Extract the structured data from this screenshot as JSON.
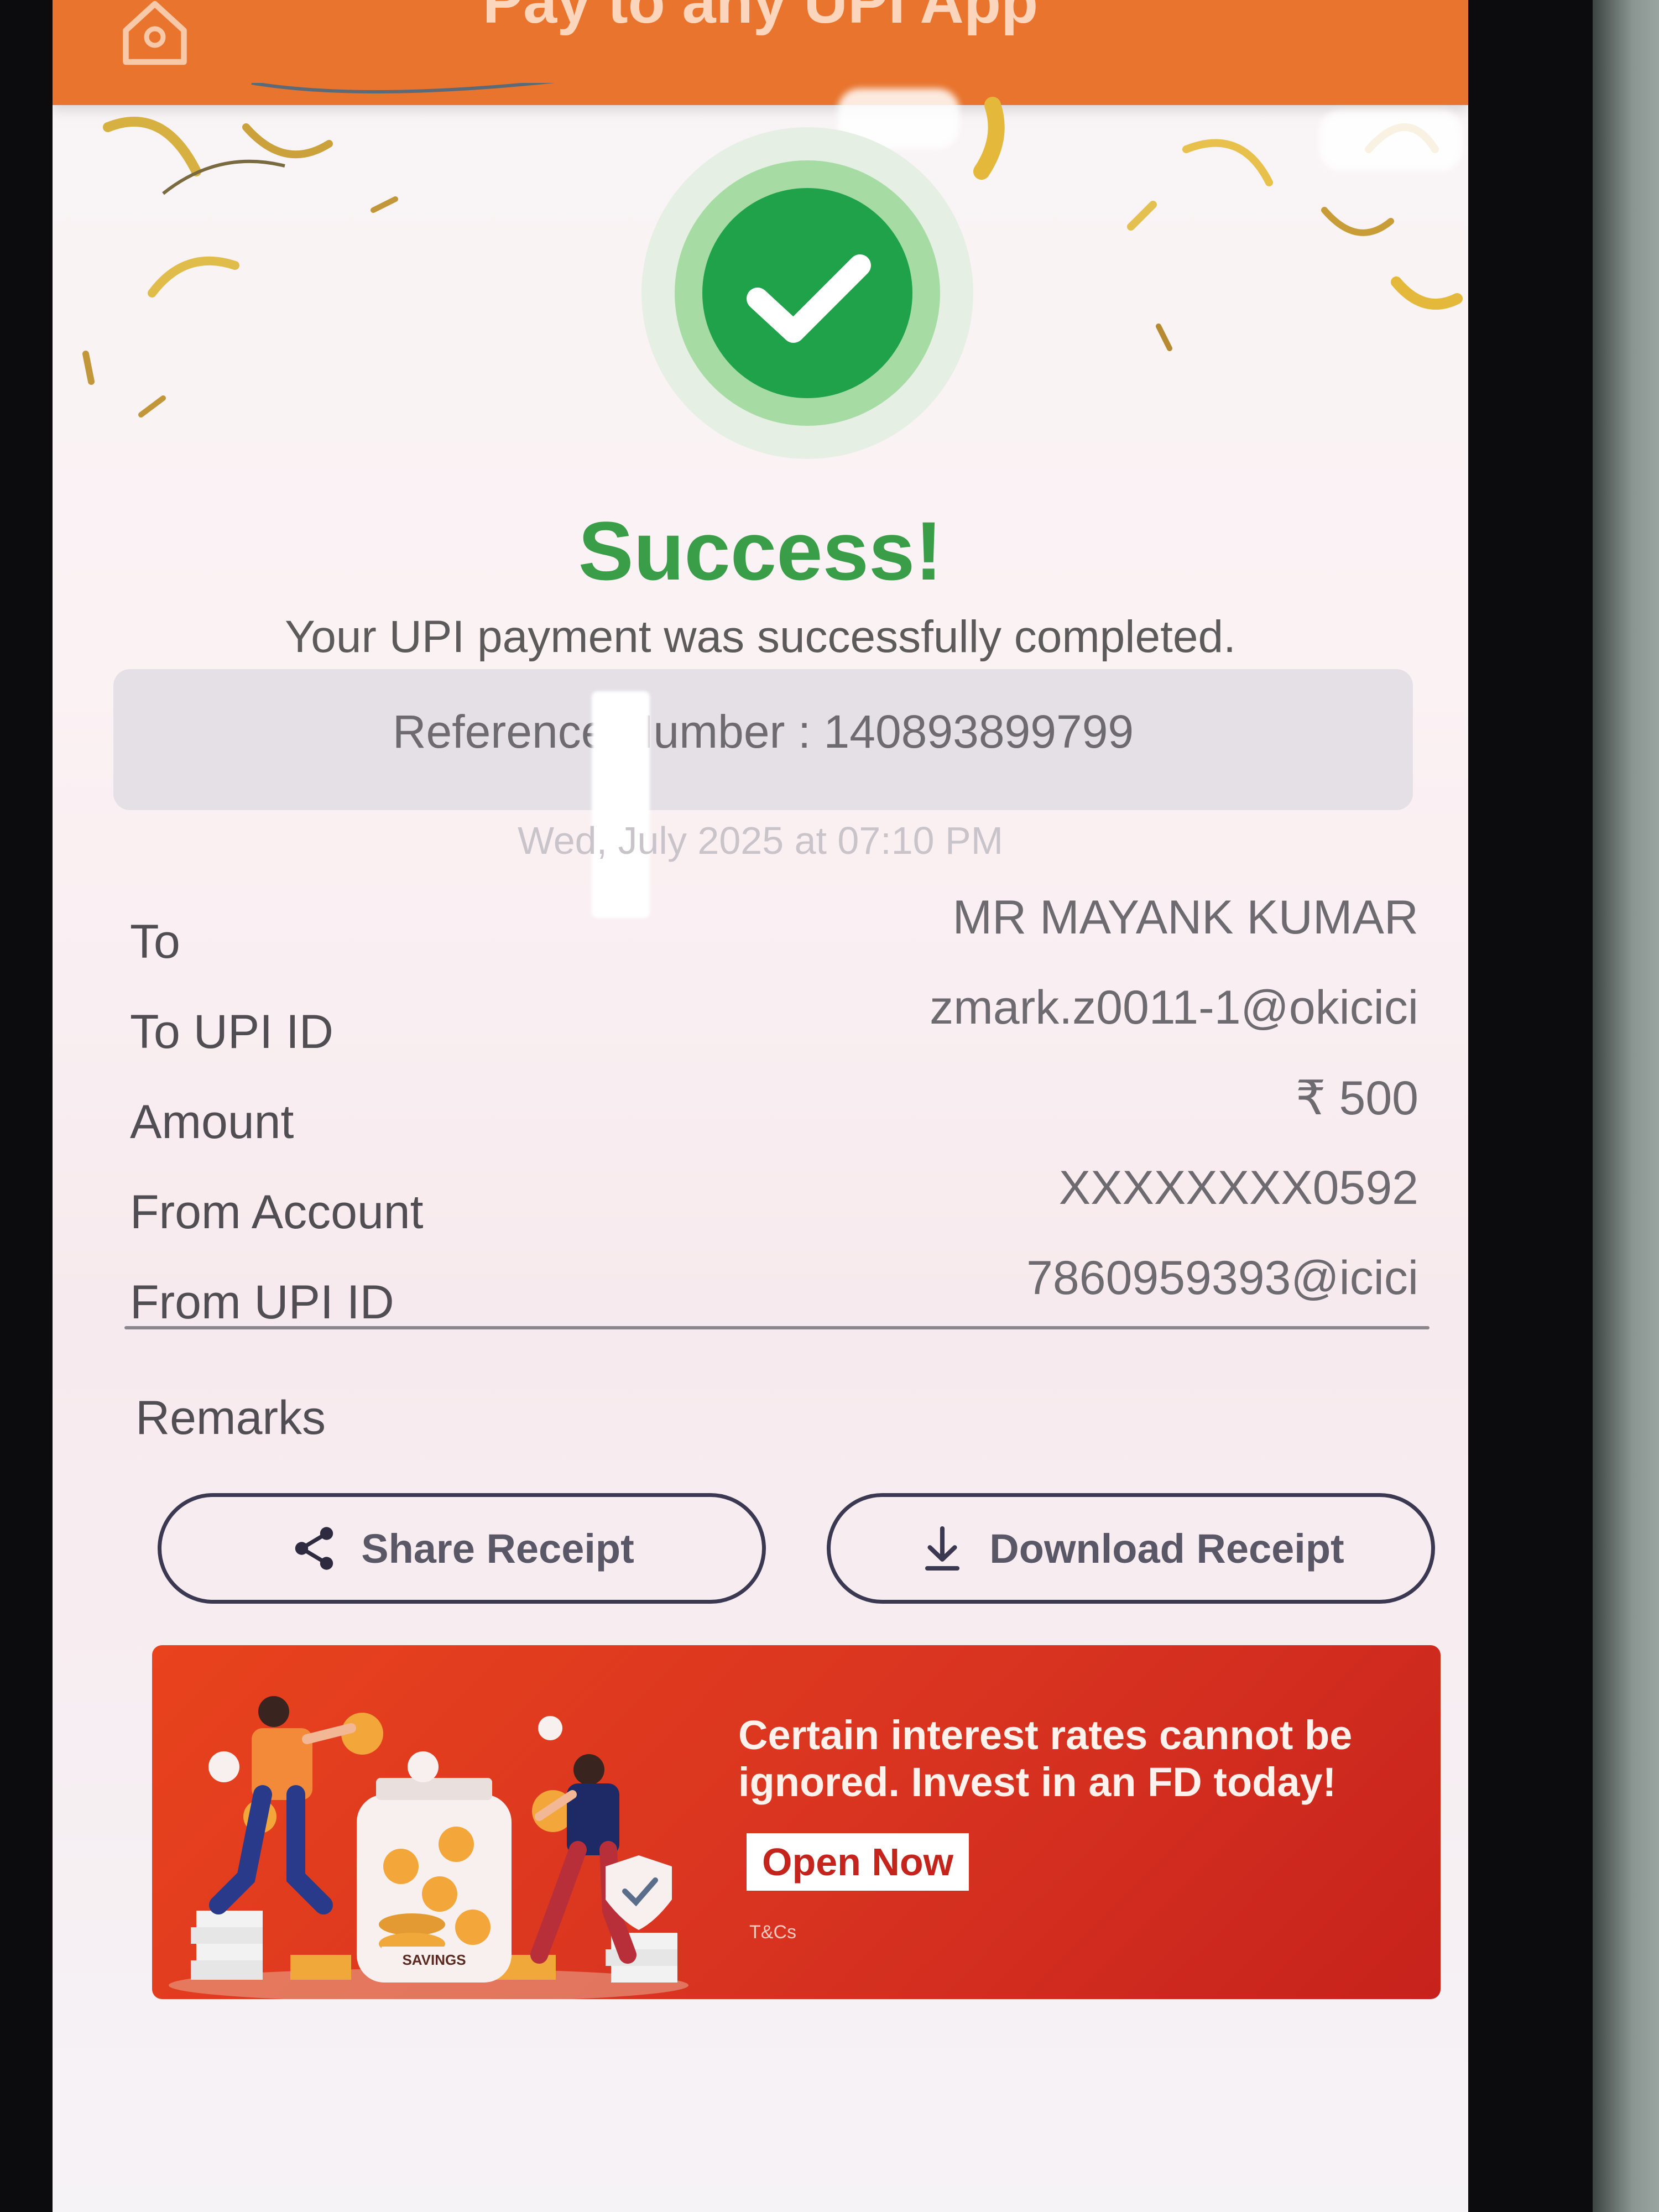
{
  "header": {
    "title": "Pay to any UPI App",
    "home_icon": "home-icon"
  },
  "status": {
    "icon": "check-circle-icon",
    "title": "Success!",
    "message": "Your UPI payment was successfully completed.",
    "color": "#3a9d48"
  },
  "reference": {
    "label": "Reference Number : 140893899799"
  },
  "date": "Wed, July 2025 at 07:10 PM",
  "details": [
    {
      "label": "To",
      "value": "MR MAYANK KUMAR"
    },
    {
      "label": "To UPI ID",
      "value": "zmark.z0011-1@okicici"
    },
    {
      "label": "Amount",
      "value": "₹ 500"
    },
    {
      "label": "From Account",
      "value": "XXXXXXXX0592"
    },
    {
      "label": "From UPI ID",
      "value": "7860959393@icici"
    }
  ],
  "remarks": {
    "label": "Remarks"
  },
  "actions": {
    "share_label": "Share Receipt",
    "share_icon": "share-icon",
    "download_label": "Download Receipt",
    "download_icon": "download-icon"
  },
  "promo": {
    "text": "Certain interest rates cannot be ignored. Invest in an FD today!",
    "cta": "Open Now",
    "tc": "T&Cs",
    "jar_label": "SAVINGS",
    "accent": "#e8431d"
  }
}
